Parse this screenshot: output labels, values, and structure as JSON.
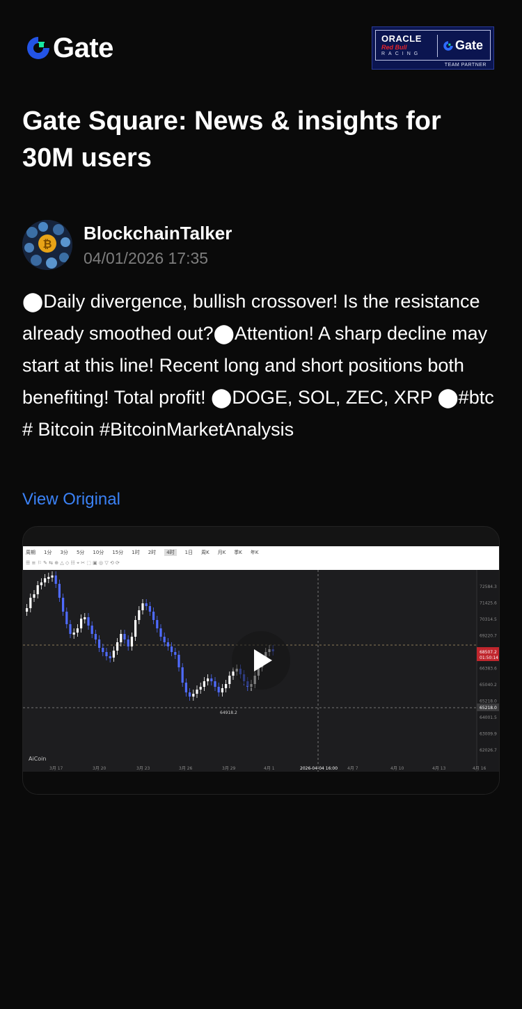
{
  "header": {
    "brand": "Gate",
    "partner": {
      "line1": "ORACLE",
      "line2": "Red Bull",
      "line3": "RACING",
      "brand": "Gate",
      "badge": "TEAM PARTNER"
    }
  },
  "page": {
    "title": "Gate Square: News & insights for 30M users"
  },
  "post": {
    "author": "BlockchainTalker",
    "timestamp": "04/01/2026 17:35",
    "body": "⬤Daily divergence, bullish crossover! Is the resistance already smoothed out?⬤Attention! A sharp decline may start at this line! Recent long and short positions both benefiting! Total profit! ⬤DOGE, SOL, ZEC, XRP ⬤#btc # Bitcoin #BitcoinMarketAnalysis",
    "view_original": "View Original"
  },
  "video": {
    "chart": {
      "low_label": "64918.2",
      "price_labels": [
        "72584.3",
        "71425.6",
        "70314.5",
        "69220.7",
        "68507.2",
        "66383.6",
        "65040.2",
        "65218.0",
        "64001.5",
        "63009.9",
        "62026.7"
      ],
      "current_price": "68507.2",
      "countdown": "01:50:14",
      "crosshair_price": "65218.0",
      "date_labels": [
        "3月 17",
        "3月 20",
        "3月 23",
        "3月 26",
        "3月 29",
        "4月 1",
        "2026-04-04 16:00",
        "4月 7",
        "4月 10",
        "4月 13",
        "4月 16"
      ],
      "timeframes": [
        "周期",
        "1分",
        "3分",
        "5分",
        "10分",
        "15分",
        "1时",
        "2时",
        "4时",
        "1日",
        "周K",
        "月K",
        "季K",
        "年K"
      ],
      "watermark": "AiCoin"
    },
    "colors": {
      "up": "#ffffff",
      "down": "#4f6bff",
      "accent": "#3b82f6"
    }
  }
}
